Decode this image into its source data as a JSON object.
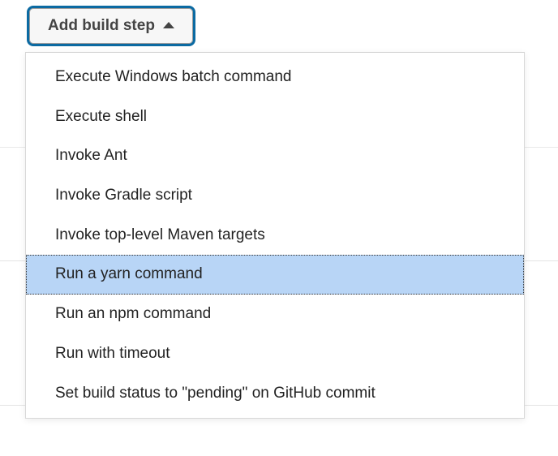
{
  "button": {
    "label": "Add build step"
  },
  "menu": {
    "items": [
      {
        "label": "Execute Windows batch command",
        "highlighted": false
      },
      {
        "label": "Execute shell",
        "highlighted": false
      },
      {
        "label": "Invoke Ant",
        "highlighted": false
      },
      {
        "label": "Invoke Gradle script",
        "highlighted": false
      },
      {
        "label": "Invoke top-level Maven targets",
        "highlighted": false
      },
      {
        "label": "Run a yarn command",
        "highlighted": true
      },
      {
        "label": "Run an npm command",
        "highlighted": false
      },
      {
        "label": "Run with timeout",
        "highlighted": false
      },
      {
        "label": "Set build status to \"pending\" on GitHub commit",
        "highlighted": false
      }
    ]
  }
}
